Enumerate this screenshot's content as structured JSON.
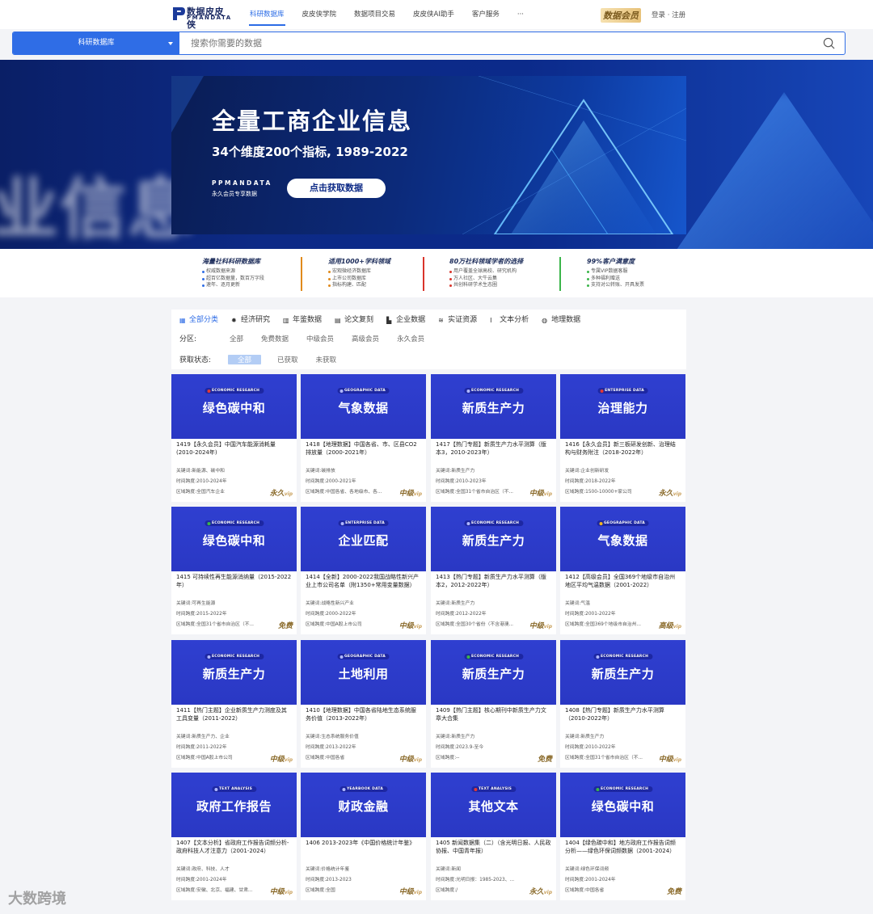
{
  "nav": {
    "logo_cn": "数据皮皮侠",
    "logo_en": "PMANDATA",
    "items": [
      "科研数据库",
      "皮皮侠学院",
      "数据项目交易",
      "皮皮侠AI助手",
      "客户服务",
      "···"
    ],
    "vip": "数据会员",
    "login": "登录",
    "register": "注册"
  },
  "search": {
    "category": "科研数据库",
    "placeholder": "搜索你需要的数据"
  },
  "hero": {
    "bg_text": "业信息",
    "title": "全量工商企业信息",
    "subtitle": "34个维度200个指标, 1989-2022",
    "brand": "PPMANDATA",
    "brand_sub": "永久会员专享数据",
    "button": "点击获取数据"
  },
  "features": [
    {
      "title": "海量社科科研数据库",
      "color": "#2f6de6",
      "items": [
        "权威数据来源",
        "超百亿数据量，数百万字段",
        "速年、逐月更新"
      ]
    },
    {
      "title": "适用1000+学科领域",
      "color": "#e08a1c",
      "items": [
        "宏观微经济数据库",
        "上市公司数据库",
        "指标构建、匹配"
      ]
    },
    {
      "title": "80万社科领域学者的选择",
      "color": "#d9342b",
      "items": [
        "用户覆盖全球高校、研究机构",
        "万人社区、大牛云集",
        "共创科研学术生态圈"
      ]
    },
    {
      "title": "99%客户满意度",
      "color": "#3bb54a",
      "items": [
        "专属VIP数据客服",
        "多种福利赠送",
        "支持对公转账、开具发票"
      ]
    }
  ],
  "tabs": [
    "全部分类",
    "经济研究",
    "年鉴数据",
    "论文复刻",
    "企业数据",
    "实证资源",
    "文本分析",
    "地理数据"
  ],
  "filters": {
    "zone_label": "分区:",
    "zone_options": [
      "全部",
      "免费数据",
      "中级会员",
      "高级会员",
      "永久会员"
    ],
    "status_label": "获取状态:",
    "status_options": [
      "全部",
      "已获取",
      "未获取"
    ]
  },
  "meta_labels": {
    "keyword": "关键词:",
    "time": "时间跨度:",
    "region": "区域跨度:"
  },
  "cards": [
    {
      "tag": "ECONOMIC RESEARCH",
      "dot": "#e53935",
      "big": "绿色碳中和",
      "title": "1419【永久会员】中国汽车能源消耗量(2010-2024年)",
      "keyword": "新能源、碳中和",
      "time": "2010-2024年",
      "region": "全国汽车企业",
      "badge": "永久",
      "badge_sub": "vip"
    },
    {
      "tag": "GEOGRAPHIC DATA",
      "dot": "#b0b8ff",
      "big": "气象数据",
      "title": "1418【地理数据】中国各省、市、区县CO2排放量（2000-2021年）",
      "keyword": "碳排放",
      "time": "2000-2021年",
      "region": "中国各省、各地级市、各...",
      "badge": "中级",
      "badge_sub": "vip"
    },
    {
      "tag": "ECONOMIC RESEARCH",
      "dot": "#b0b8ff",
      "big": "新质生产力",
      "title": "1417【热门专题】新质生产力水平测算（版本3，2010-2023年）",
      "keyword": "新质生产力",
      "time": "2010-2023年",
      "region": "全国31个省市自治区（不...",
      "badge": "中级",
      "badge_sub": "vip"
    },
    {
      "tag": "ENTERPRISE DATA",
      "dot": "#e53935",
      "big": "治理能力",
      "title": "1416【永久会员】新三板研发创新、治理结构与财务附注（2018-2022年）",
      "keyword": "企业创新研发",
      "time": "2018-2022年",
      "region": "1500-10000+家公司",
      "badge": "永久",
      "badge_sub": "vip"
    },
    {
      "tag": "ECONOMIC RESEARCH",
      "dot": "#3bb54a",
      "big": "绿色碳中和",
      "title": "1415 可持续性再生能源消纳量（2015-2022年）",
      "keyword": "可再生能源",
      "time": "2015-2022年",
      "region": "全国31个省市自治区（不...",
      "badge": "免费",
      "badge_sub": ""
    },
    {
      "tag": "ENTERPRISE DATA",
      "dot": "#b0b8ff",
      "big": "企业匹配",
      "title": "1414【全新】2000-2022我国战略性新兴产业上市公司名单（附1350+常用变量数据）",
      "keyword": "战略性新兴产业",
      "time": "2000-2022年",
      "region": "中国A股上市公司",
      "badge": "中级",
      "badge_sub": "vip"
    },
    {
      "tag": "ECONOMIC RESEARCH",
      "dot": "#b0b8ff",
      "big": "新质生产力",
      "title": "1413【热门专题】新质生产力水平测算（版本2，2012-2022年）",
      "keyword": "新质生产力",
      "time": "2012-2022年",
      "region": "全国30个省份（不含港澳...",
      "badge": "中级",
      "badge_sub": "vip"
    },
    {
      "tag": "GEOGRAPHIC DATA",
      "dot": "#f3b61f",
      "big": "气象数据",
      "title": "1412【高级会员】全国369个地级市自治州地区平均气温数据（2001-2022）",
      "keyword": "气温",
      "time": "2001-2022年",
      "region": "全国369个地级市自治州...",
      "badge": "高级",
      "badge_sub": "vip"
    },
    {
      "tag": "ECONOMIC RESEARCH",
      "dot": "#b0b8ff",
      "big": "新质生产力",
      "title": "1411【热门主题】企业新质生产力测度及其工具变量（2011-2022）",
      "keyword": "新质生产力、企业",
      "time": "2011-2022年",
      "region": "中国A股上市公司",
      "badge": "中级",
      "badge_sub": "vip"
    },
    {
      "tag": "GEOGRAPHIC DATA",
      "dot": "#b0b8ff",
      "big": "土地利用",
      "title": "1410【地理数据】中国各省陆地生态系统服务价值（2013-2022年）",
      "keyword": "生态系统服务价值",
      "time": "2013-2022年",
      "region": "中国各省",
      "badge": "中级",
      "badge_sub": "vip"
    },
    {
      "tag": "ECONOMIC RESEARCH",
      "dot": "#3bb54a",
      "big": "新质生产力",
      "title": "1409【热门主题】核心期刊中新质生产力文章大合集",
      "keyword": "新质生产力",
      "time": "2023.9-至今",
      "region": "--",
      "badge": "免费",
      "badge_sub": ""
    },
    {
      "tag": "ECONOMIC RESEARCH",
      "dot": "#b0b8ff",
      "big": "新质生产力",
      "title": "1408【热门专题】新质生产力水平测算（2010-2022年）",
      "keyword": "新质生产力",
      "time": "2010-2022年",
      "region": "全国31个省市自治区（不...",
      "badge": "中级",
      "badge_sub": "vip"
    },
    {
      "tag": "TEXT ANALYSIS",
      "dot": "#b0b8ff",
      "big": "政府工作报告",
      "title": "1407【文本分析】省政府工作报告词频分析-政府科技人才注意力（2001-2024）",
      "keyword": "政府、科技、人才",
      "time": "2001-2024年",
      "region": "安徽、北京、福建、甘肃...",
      "badge": "中级",
      "badge_sub": "vip"
    },
    {
      "tag": "YEARBOOK DATA",
      "dot": "#b0b8ff",
      "big": "财政金融",
      "title": "1406 2013-2023年《中国价格统计年鉴》",
      "keyword": "价格统计年鉴",
      "time": "2013-2023",
      "region": "全国",
      "badge": "中级",
      "badge_sub": "vip"
    },
    {
      "tag": "TEXT ANALYSIS",
      "dot": "#e53935",
      "big": "其他文本",
      "title": "1405 新闻数据集（二）（含光明日报、人民政协报、中国青年报）",
      "keyword": "新闻",
      "time": "光明日报：1985-2023、...",
      "region": "/",
      "badge": "永久",
      "badge_sub": "vip"
    },
    {
      "tag": "ECONOMIC RESEARCH",
      "dot": "#3bb54a",
      "big": "绿色碳中和",
      "title": "1404【绿色碳中和】地方政府工作报告词频分析——绿色环保词频数据（2001-2024）",
      "keyword": "绿色环保词频",
      "time": "2001-2024年",
      "region": "中国各省",
      "badge": "免费",
      "badge_sub": ""
    }
  ],
  "watermark": "大数跨境"
}
